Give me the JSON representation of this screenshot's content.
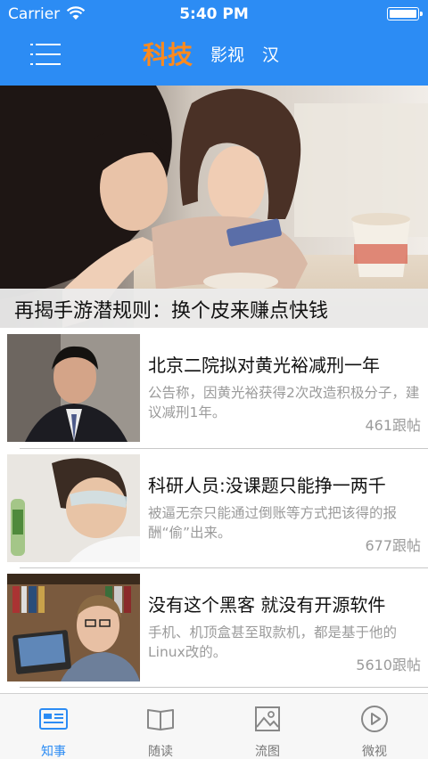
{
  "status_bar": {
    "carrier": "Carrier",
    "time": "5:40 PM"
  },
  "nav": {
    "tabs": [
      {
        "label": "科技",
        "active": true
      },
      {
        "label": "影视",
        "active": false
      },
      {
        "label": "汉",
        "active": false
      }
    ]
  },
  "hero": {
    "caption": "再揭手游潜规则：换个皮来赚点快钱"
  },
  "news": [
    {
      "title": "北京二院拟对黄光裕减刑一年",
      "summary": "公告称，因黄光裕获得2次改造积极分子，建议减刑1年。",
      "count": "461跟帖"
    },
    {
      "title": "科研人员:没课题只能挣一两千",
      "summary": "被逼无奈只能通过倒账等方式把该得的报酬“偷”出来。",
      "count": "677跟帖"
    },
    {
      "title": "没有这个黑客 就没有开源软件",
      "summary": "手机、机顶盒甚至取款机，都是基于他的Linux改的。",
      "count": "5610跟帖"
    }
  ],
  "tabbar": {
    "items": [
      {
        "label": "知事",
        "icon": "news-icon",
        "active": true
      },
      {
        "label": "随读",
        "icon": "book-icon",
        "active": false
      },
      {
        "label": "流图",
        "icon": "picture-icon",
        "active": false
      },
      {
        "label": "微视",
        "icon": "play-icon",
        "active": false
      }
    ]
  },
  "colors": {
    "primary": "#2c8cf4",
    "active_tab": "#ff8a1c",
    "muted_text": "#9b9b9b"
  }
}
